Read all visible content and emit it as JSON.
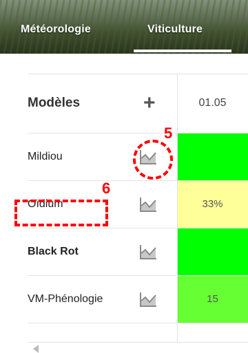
{
  "tabs": [
    {
      "label": "Météorologie",
      "active": false
    },
    {
      "label": "Viticulture",
      "active": true
    }
  ],
  "table": {
    "header": {
      "title": "Modèles",
      "add_icon": "plus-icon",
      "date": "01.05"
    },
    "rows": [
      {
        "name": "Mildiou",
        "icon": "chart-icon",
        "value": "",
        "color": "#00ff00",
        "bold": false
      },
      {
        "name": "Oïdium",
        "icon": "chart-icon",
        "value": "33%",
        "color": "#ffff99",
        "bold": false
      },
      {
        "name": "Black Rot",
        "icon": "chart-icon",
        "value": "",
        "color": "#00ff00",
        "bold": true
      },
      {
        "name": "VM-Phénologie",
        "icon": "chart-icon",
        "value": "15",
        "color": "#66ff33",
        "bold": false
      }
    ]
  },
  "annotations": {
    "circle_label": "5",
    "rect_label": "6",
    "color": "#ff0000"
  },
  "colors": {
    "green": "#00ff00",
    "light_green": "#66ff33",
    "yellow": "#ffff99"
  }
}
